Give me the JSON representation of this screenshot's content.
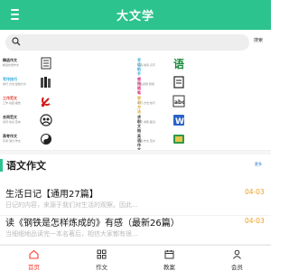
{
  "header": {
    "title": "大文学",
    "menu_icon": "menu-icon"
  },
  "search": {
    "placeholder": "",
    "button_label": "搜索"
  },
  "categories": [
    {
      "title": "精选作文",
      "subtitle": "精选优秀作文",
      "title_color": "#333333",
      "icon": "list-icon"
    },
    {
      "title": "写话助手",
      "subtitle": "写话·拼音·汉字",
      "title_color": "#2aa9d8",
      "icon": "yu-icon"
    },
    {
      "title": "写作技巧",
      "subtitle": "技巧·方法·经验分享",
      "title_color": "#2aa9d8",
      "icon": "books-icon"
    },
    {
      "title": "感悟随笔",
      "subtitle": "人生感悟·随笔",
      "title_color": "#d92a7a",
      "icon": "document-icon"
    },
    {
      "title": "工作范文",
      "subtitle": "工作·总结·报告",
      "title_color": "#e03a2f",
      "icon": "party-emblem-icon"
    },
    {
      "title": "学习方法",
      "subtitle": "学习·方法·技巧",
      "title_color": "#e0a020",
      "icon": "abc-icon"
    },
    {
      "title": "合同范文",
      "subtitle": "合同·协议·范本",
      "title_color": "#333333",
      "icon": "team-icon"
    },
    {
      "title": "求职文档",
      "subtitle": "简历·求职·面试",
      "title_color": "#333333",
      "icon": "word-doc-icon"
    },
    {
      "title": "高考作文",
      "subtitle": "高考·满分·作文",
      "title_color": "#333333",
      "icon": "yin-yang-icon"
    },
    {
      "title": "英语作文",
      "subtitle": "英语·作文·范文",
      "title_color": "#333333",
      "icon": "certificate-icon"
    }
  ],
  "section": {
    "title": "语文作文",
    "more_label": "更多"
  },
  "articles": [
    {
      "title": "生活日记【通用27篇】",
      "date": "04-03",
      "desc": "日记的内容，来源于我们对生活的观察。因此..."
    },
    {
      "title": "读《钢铁是怎样炼成的》有感（最新26篇）",
      "date": "04-03",
      "desc": "当细细地品读完一本名著后，相信大家都有很..."
    }
  ],
  "nav": [
    {
      "label": "首页",
      "icon": "home-icon",
      "active": true
    },
    {
      "label": "作文",
      "icon": "grid-icon",
      "active": false
    },
    {
      "label": "教案",
      "icon": "calendar-icon",
      "active": false
    },
    {
      "label": "会员",
      "icon": "user-icon",
      "active": false
    }
  ],
  "colors": {
    "brand": "#2cc38e",
    "active": "#ff3b30",
    "date": "#f0a020",
    "link": "#1e73c8"
  }
}
